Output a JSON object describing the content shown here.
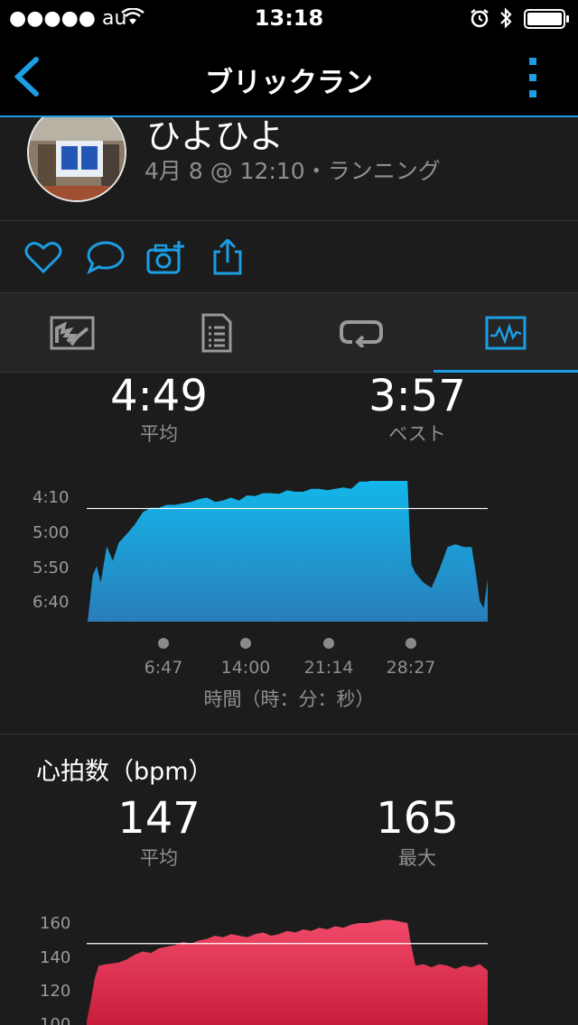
{
  "status_bar": {
    "carrier": "●●●●● au",
    "time": "13:18",
    "icons": [
      "wifi-icon",
      "alarm-icon",
      "bluetooth-icon",
      "battery-icon"
    ]
  },
  "nav": {
    "title": "ブリックラン",
    "back_icon": "chevron-left-icon",
    "more_icon": "vertical-dots-icon",
    "accent_color": "#1b9ee3"
  },
  "profile": {
    "name": "ひよひよ",
    "meta": "4月 8 @ 12:10・ランニング"
  },
  "actions": [
    "heart-icon",
    "comment-icon",
    "add-photo-icon",
    "share-icon"
  ],
  "tabs": [
    {
      "icon": "map-icon",
      "active": false
    },
    {
      "icon": "details-icon",
      "active": false
    },
    {
      "icon": "laps-icon",
      "active": false
    },
    {
      "icon": "chart-icon",
      "active": true
    }
  ],
  "pace": {
    "avg_value": "4:49",
    "avg_label": "平均",
    "best_value": "3:57",
    "best_label": "ベスト",
    "color": "#1a8fd0",
    "chart_data": {
      "type": "area",
      "y_tick_labels": [
        "4:10",
        "5:00",
        "5:50",
        "6:40"
      ],
      "x_tick_labels": [
        "6:47",
        "14:00",
        "21:14",
        "28:27"
      ],
      "x_title": "時間（時：分：秒）",
      "reference_line": "4:49",
      "x": [
        0,
        1.5,
        2.5,
        3.5,
        5,
        6.5,
        8,
        10,
        12,
        14,
        16,
        18,
        20,
        22,
        24,
        26,
        28,
        30,
        32,
        34,
        36,
        38,
        40,
        42,
        44,
        46,
        48,
        50,
        52,
        54,
        56,
        58,
        60,
        62,
        64,
        66,
        68,
        70,
        72,
        74,
        76,
        78,
        80,
        80.5,
        81,
        82,
        84,
        86,
        88,
        90,
        92,
        94,
        96,
        97,
        98,
        99,
        100
      ],
      "y_values_sec_per_km": [
        440,
        365,
        352,
        375,
        325,
        345,
        320,
        308,
        295,
        278,
        272,
        272,
        268,
        268,
        266,
        264,
        260,
        258,
        264,
        262,
        258,
        262,
        255,
        256,
        252,
        252,
        253,
        248,
        250,
        250,
        246,
        246,
        248,
        246,
        244,
        246,
        236,
        236,
        234,
        234,
        234,
        234,
        234,
        300,
        350,
        362,
        375,
        382,
        356,
        326,
        322,
        326,
        326,
        360,
        400,
        410,
        370
      ]
    }
  },
  "heart_rate": {
    "section_title": "心拍数（bpm）",
    "avg_value": "147",
    "avg_label": "平均",
    "max_value": "165",
    "max_label": "最大",
    "color": "#d8284a",
    "chart_data": {
      "type": "area",
      "y_tick_labels": [
        "160",
        "140",
        "120",
        "100"
      ],
      "reference_line": 147,
      "x": [
        0,
        1,
        2,
        3,
        5,
        8,
        10,
        12,
        14,
        16,
        18,
        20,
        22,
        24,
        26,
        28,
        30,
        32,
        34,
        36,
        38,
        40,
        42,
        44,
        46,
        48,
        50,
        52,
        54,
        56,
        58,
        60,
        62,
        64,
        66,
        68,
        70,
        72,
        74,
        76,
        78,
        80,
        81,
        82,
        84,
        86,
        88,
        90,
        92,
        94,
        96,
        98,
        100
      ],
      "values": [
        98,
        110,
        125,
        133,
        134,
        135,
        137,
        140,
        142,
        141,
        144,
        145,
        146,
        148,
        147,
        149,
        150,
        152,
        151,
        153,
        152,
        151,
        153,
        154,
        152,
        153,
        155,
        154,
        156,
        155,
        157,
        156,
        158,
        157,
        159,
        160,
        160,
        161,
        162,
        162,
        161,
        160,
        145,
        133,
        134,
        132,
        134,
        133,
        131,
        133,
        132,
        134,
        130
      ]
    }
  }
}
